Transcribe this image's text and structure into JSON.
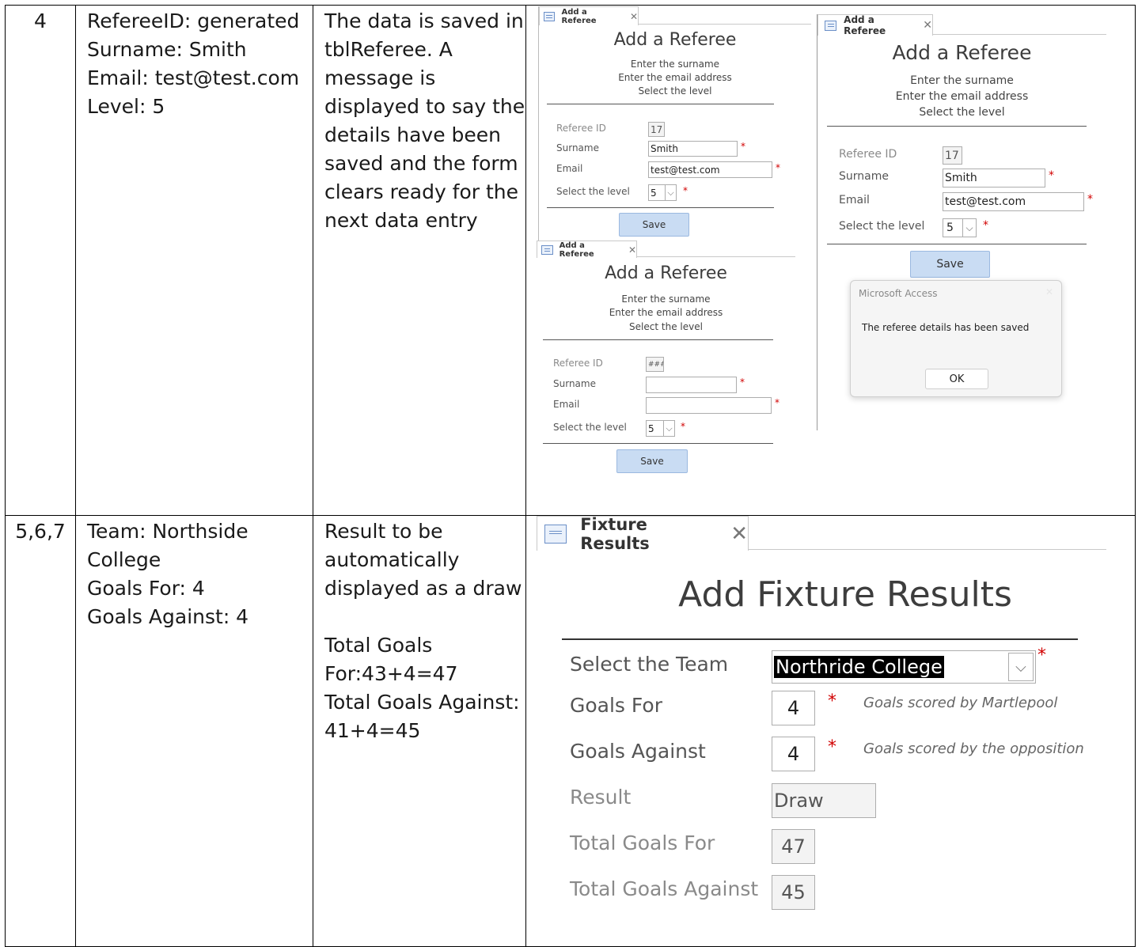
{
  "rows": [
    {
      "number": "4",
      "test_data": "RefereeID: generated\nSurname: Smith\nEmail: test@test.com\nLevel: 5",
      "expected": "The data is saved in tblReferee. A message is displayed to say the details have been saved and the form clears ready for the next data entry"
    },
    {
      "number": "5,6,7",
      "test_data": "Team: Northside College\nGoals For: 4\nGoals Against: 4",
      "expected": "Result to be automatically displayed as a draw\n\nTotal Goals For:43+4=47\nTotal Goals Against: 41+4=45"
    }
  ],
  "referee_form": {
    "tab_title": "Add a Referee",
    "heading": "Add a Referee",
    "instr1": "Enter the surname",
    "instr2": "Enter the email address",
    "instr3": "Select the level",
    "label_id": "Referee ID",
    "label_surname": "Surname",
    "label_email": "Email",
    "label_level": "Select the level",
    "save_label": "Save",
    "required": "*",
    "close": "✕",
    "combo_arrow": "⌵",
    "filled": {
      "id": "17",
      "surname": "Smith",
      "email": "test@test.com",
      "level": "5"
    },
    "cleared": {
      "id": "###",
      "surname": "",
      "email": "",
      "level": "5"
    }
  },
  "dialog": {
    "title": "Microsoft Access",
    "close": "✕",
    "message": "The referee details has been saved",
    "ok": "OK"
  },
  "fixture_form": {
    "tab_title": "Fixture Results",
    "close": "✕",
    "heading": "Add Fixture Results",
    "label_team": "Select the Team",
    "team_value": "Northride College",
    "label_goals_for": "Goals For",
    "goals_for": "4",
    "hint_for": "Goals scored by Martlepool",
    "label_goals_against": "Goals Against",
    "goals_against": "4",
    "hint_against": "Goals scored by the opposition",
    "label_result": "Result",
    "result": "Draw",
    "label_total_for": "Total Goals For",
    "total_for": "47",
    "label_total_against": "Total Goals Against",
    "total_against": "45",
    "required": "*",
    "combo_arrow": "⌵"
  },
  "colors": {
    "required": "#d10000",
    "button": "#c9dcf3",
    "selected_text_bg": "#000000"
  }
}
